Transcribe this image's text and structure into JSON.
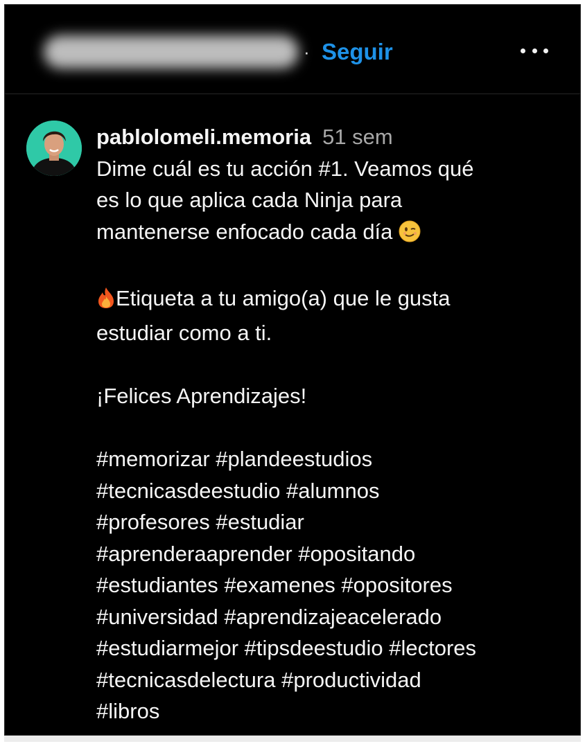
{
  "header": {
    "username_blurred": "",
    "separator": "·",
    "follow_label": "Seguir",
    "more_icon": "more-horizontal-icon"
  },
  "post": {
    "username": "pablolomeli.memoria",
    "time_ago": "51 sem",
    "paragraph1_line1": "Dime cuál es tu acción #1. Veamos qué",
    "paragraph1_line2": "es lo que aplica cada Ninja para",
    "paragraph1_line3": "mantenerse enfocado cada día",
    "paragraph2_line1": "Etiqueta a tu amigo(a) que le gusta",
    "paragraph2_line2": "estudiar como a ti.",
    "paragraph3": "¡Felices Aprendizajes!",
    "hashtag_lines": [
      [
        "#memorizar",
        "#plandeestudios"
      ],
      [
        "#tecnicasdeestudio",
        "#alumnos"
      ],
      [
        "#profesores",
        "#estudiar"
      ],
      [
        "#aprenderaaprender",
        "#opositando"
      ],
      [
        "#estudiantes",
        "#examenes",
        "#opositores"
      ],
      [
        "#universidad",
        "#aprendizajeacelerado"
      ],
      [
        "#estudiarmejor",
        "#tipsdeestudio",
        "#lectores"
      ],
      [
        "#tecnicasdelectura",
        "#productividad"
      ],
      [
        "#libros"
      ]
    ]
  },
  "icons": {
    "wink_emoji": "wink-emoji-icon",
    "fire_emoji": "fire-emoji-icon",
    "avatar": "avatar"
  },
  "colors": {
    "background": "#000000",
    "text": "#f5f5f5",
    "muted": "#a8a8a8",
    "accent": "#1e92e8"
  }
}
